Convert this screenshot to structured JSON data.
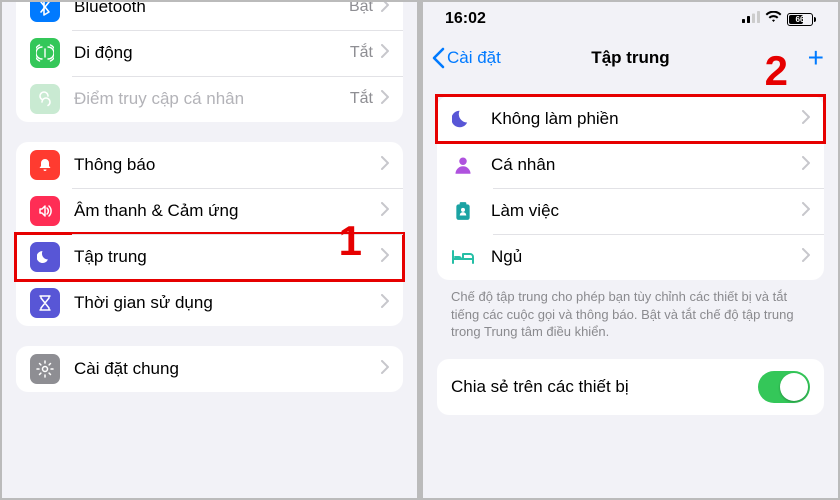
{
  "left": {
    "group1": [
      {
        "id": "bluetooth",
        "label": "Bluetooth",
        "value": "Bật",
        "iconColor": "#007aff"
      },
      {
        "id": "cellular",
        "label": "Di động",
        "value": "Tắt",
        "iconColor": "#34c759"
      },
      {
        "id": "hotspot",
        "label": "Điểm truy cập cá nhân",
        "value": "Tắt",
        "iconColor": "#34c759",
        "disabled": true
      }
    ],
    "group2": [
      {
        "id": "notifications",
        "label": "Thông báo",
        "iconColor": "#ff3b30"
      },
      {
        "id": "sounds",
        "label": "Âm thanh & Cảm ứng",
        "iconColor": "#ff375f"
      },
      {
        "id": "focus",
        "label": "Tập trung",
        "iconColor": "#5856d6",
        "highlighted": true
      },
      {
        "id": "screentime",
        "label": "Thời gian sử dụng",
        "iconColor": "#5856d6"
      }
    ],
    "group3": [
      {
        "id": "general",
        "label": "Cài đặt chung",
        "iconColor": "#8e8e93"
      }
    ],
    "annotation": "1"
  },
  "right": {
    "status": {
      "time": "16:02",
      "battery": "66"
    },
    "nav": {
      "back": "Cài đặt",
      "title": "Tập trung",
      "plus": "+"
    },
    "modes": [
      {
        "id": "dnd",
        "label": "Không làm phiền",
        "highlighted": true,
        "color": "#5856d6"
      },
      {
        "id": "personal",
        "label": "Cá nhân",
        "color": "#af52de"
      },
      {
        "id": "work",
        "label": "Làm việc",
        "color": "#1aa3a3"
      },
      {
        "id": "sleep",
        "label": "Ngủ",
        "color": "#26bfa6"
      }
    ],
    "footer": "Chế độ tập trung cho phép bạn tùy chỉnh các thiết bị và tắt tiếng các cuộc gọi và thông báo. Bật và tắt chế độ tập trung trong Trung tâm điều khiển.",
    "share": {
      "label": "Chia sẻ trên các thiết bị",
      "on": true
    },
    "annotation": "2"
  }
}
